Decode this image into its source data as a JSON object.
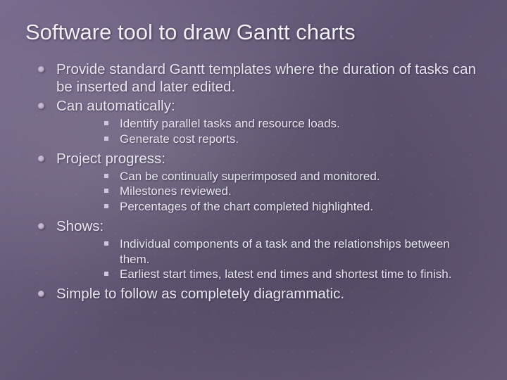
{
  "title": "Software tool to draw Gantt charts",
  "items": {
    "l1a": "Provide standard Gantt templates where the duration of tasks can be inserted and later edited.",
    "l1b": "Can automatically:",
    "l2a": "Identify parallel tasks and resource loads.",
    "l2b": "Generate cost reports.",
    "l1c": "Project progress:",
    "l2c": "Can be continually superimposed and monitored.",
    "l2d": "Milestones reviewed.",
    "l2e": "Percentages of the chart completed highlighted.",
    "l1d": "Shows:",
    "l2f": "Individual components of a task and the relationships between them.",
    "l2g": "Earliest start times, latest end times and shortest time to finish.",
    "l1e": "Simple to follow as completely diagrammatic."
  }
}
